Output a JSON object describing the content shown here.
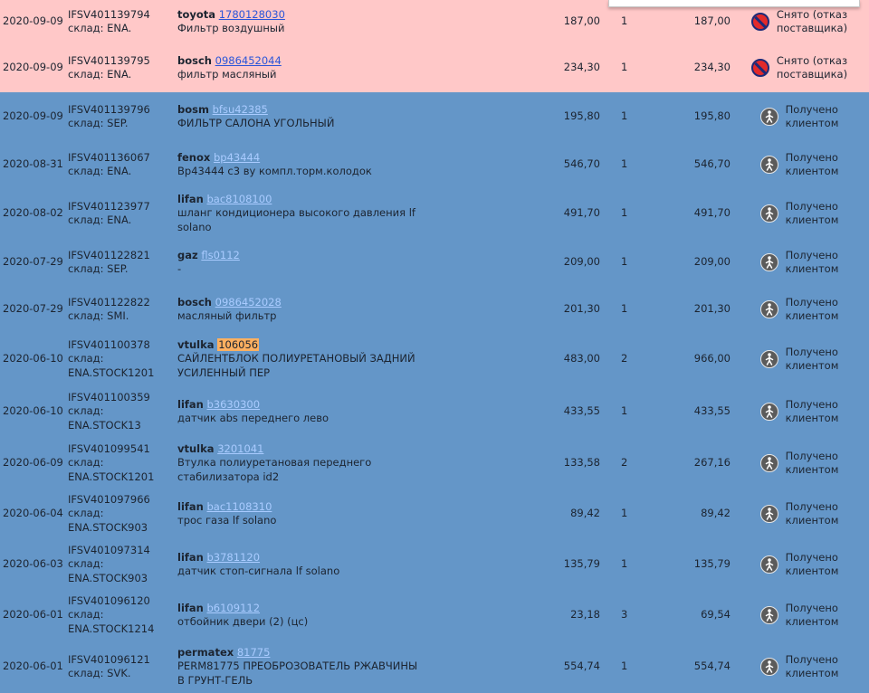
{
  "colors": {
    "cancelled_row": "#ffc8c8",
    "received_row": "#6496c8",
    "link": "#2b55d8",
    "highlight": "#ffb060"
  },
  "orders": [
    {
      "date": "2020-09-09",
      "order_id": "IFSV401139794",
      "warehouse": [
        "склад: ENA."
      ],
      "brand": "toyota",
      "part_number": "1780128030",
      "description": "Фильтр воздушный",
      "price": "187,00",
      "qty": "1",
      "total": "187,00",
      "status_icon": "cancelled-icon",
      "status": [
        "Снято (отказ",
        "поставщика)"
      ],
      "row_style": "cancelled"
    },
    {
      "date": "2020-09-09",
      "order_id": "IFSV401139795",
      "warehouse": [
        "склад: ENA."
      ],
      "brand": "bosch",
      "part_number": "0986452044",
      "description": "фильтр масляный",
      "price": "234,30",
      "qty": "1",
      "total": "234,30",
      "status_icon": "cancelled-icon",
      "status": [
        "Снято (отказ",
        "поставщика)"
      ],
      "row_style": "cancelled"
    },
    {
      "date": "2020-09-09",
      "order_id": "IFSV401139796",
      "warehouse": [
        "склад: SEP."
      ],
      "brand": "bosm",
      "part_number": "bfsu42385",
      "description": "ФИЛЬТР САЛОНА УГОЛЬНЫЙ",
      "price": "195,80",
      "qty": "1",
      "total": "195,80",
      "status_icon": "received-icon",
      "status": [
        "Получено",
        "клиентом"
      ],
      "row_style": "received"
    },
    {
      "date": "2020-08-31",
      "order_id": "IFSV401136067",
      "warehouse": [
        "склад: ENA."
      ],
      "brand": "fenox",
      "part_number": "bp43444",
      "description": "Bp43444 c3 ву компл.торм.колодок",
      "price": "546,70",
      "qty": "1",
      "total": "546,70",
      "status_icon": "received-icon",
      "status": [
        "Получено",
        "клиентом"
      ],
      "row_style": "received"
    },
    {
      "date": "2020-08-02",
      "order_id": "IFSV401123977",
      "warehouse": [
        "склад: ENA."
      ],
      "brand": "lifan",
      "part_number": "bac8108100",
      "description": "шланг кондиционера высокого давления lf solano",
      "price": "491,70",
      "qty": "1",
      "total": "491,70",
      "status_icon": "received-icon",
      "status": [
        "Получено",
        "клиентом"
      ],
      "row_style": "received"
    },
    {
      "date": "2020-07-29",
      "order_id": "IFSV401122821",
      "warehouse": [
        "склад: SEP."
      ],
      "brand": "gaz",
      "part_number": "fls0112",
      "description": "-",
      "price": "209,00",
      "qty": "1",
      "total": "209,00",
      "status_icon": "received-icon",
      "status": [
        "Получено",
        "клиентом"
      ],
      "row_style": "received"
    },
    {
      "date": "2020-07-29",
      "order_id": "IFSV401122822",
      "warehouse": [
        "склад: SMI."
      ],
      "brand": "bosch",
      "part_number": "0986452028",
      "description": "масляный фильтр",
      "price": "201,30",
      "qty": "1",
      "total": "201,30",
      "status_icon": "received-icon",
      "status": [
        "Получено",
        "клиентом"
      ],
      "row_style": "received"
    },
    {
      "date": "2020-06-10",
      "order_id": "IFSV401100378",
      "warehouse": [
        "склад:",
        "ENA.STOCK1201"
      ],
      "brand": "vtulka",
      "part_number": "106056",
      "part_highlighted": true,
      "description": "САЙЛЕНТБЛОК ПОЛИУРЕТАНОВЫЙ ЗАДНИЙ УСИЛЕННЫЙ ПЕР",
      "price": "483,00",
      "qty": "2",
      "total": "966,00",
      "status_icon": "received-icon",
      "status": [
        "Получено",
        "клиентом"
      ],
      "row_style": "received"
    },
    {
      "date": "2020-06-10",
      "order_id": "IFSV401100359",
      "warehouse": [
        "склад:",
        "ENA.STOCK13"
      ],
      "brand": "lifan",
      "part_number": "b3630300",
      "description": "датчик abs переднего лево",
      "price": "433,55",
      "qty": "1",
      "total": "433,55",
      "status_icon": "received-icon",
      "status": [
        "Получено",
        "клиентом"
      ],
      "row_style": "received"
    },
    {
      "date": "2020-06-09",
      "order_id": "IFSV401099541",
      "warehouse": [
        "склад:",
        "ENA.STOCK1201"
      ],
      "brand": "vtulka",
      "part_number": "3201041",
      "description": "Втулка полиуретановая переднего стабилизатора id2",
      "price": "133,58",
      "qty": "2",
      "total": "267,16",
      "status_icon": "received-icon",
      "status": [
        "Получено",
        "клиентом"
      ],
      "row_style": "received"
    },
    {
      "date": "2020-06-04",
      "order_id": "IFSV401097966",
      "warehouse": [
        "склад:",
        "ENA.STOCK903"
      ],
      "brand": "lifan",
      "part_number": "bac1108310",
      "description": "трос газа lf solano",
      "price": "89,42",
      "qty": "1",
      "total": "89,42",
      "status_icon": "received-icon",
      "status": [
        "Получено",
        "клиентом"
      ],
      "row_style": "received"
    },
    {
      "date": "2020-06-03",
      "order_id": "IFSV401097314",
      "warehouse": [
        "склад:",
        "ENA.STOCK903"
      ],
      "brand": "lifan",
      "part_number": "b3781120",
      "description": "датчик стоп-сигнала lf solano",
      "price": "135,79",
      "qty": "1",
      "total": "135,79",
      "status_icon": "received-icon",
      "status": [
        "Получено",
        "клиентом"
      ],
      "row_style": "received"
    },
    {
      "date": "2020-06-01",
      "order_id": "IFSV401096120",
      "warehouse": [
        "склад:",
        "ENA.STOCK1214"
      ],
      "brand": "lifan",
      "part_number": "b6109112",
      "description": "отбойник двери (2) (цс)",
      "price": "23,18",
      "qty": "3",
      "total": "69,54",
      "status_icon": "received-icon",
      "status": [
        "Получено",
        "клиентом"
      ],
      "row_style": "received"
    },
    {
      "date": "2020-06-01",
      "order_id": "IFSV401096121",
      "warehouse": [
        "склад: SVK."
      ],
      "brand": "permatex",
      "part_number": "81775",
      "description": "PERM81775 ПРЕОБРОЗОВАТЕЛЬ РЖАВЧИНЫ В ГРУНТ-ГЕЛЬ",
      "price": "554,74",
      "qty": "1",
      "total": "554,74",
      "status_icon": "received-icon",
      "status": [
        "Получено",
        "клиентом"
      ],
      "row_style": "received"
    }
  ]
}
